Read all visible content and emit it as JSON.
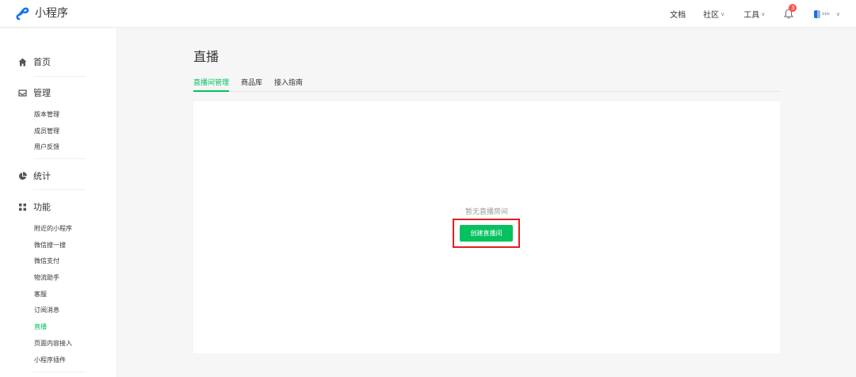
{
  "header": {
    "app_name": "小程序",
    "nav": {
      "docs": "文档",
      "community": "社区",
      "tools": "工具"
    },
    "notification_count": "3",
    "avatar_label": "bbb"
  },
  "sidebar": {
    "home": "首页",
    "manage": {
      "label": "管理",
      "items": [
        "版本管理",
        "成员管理",
        "用户反馈"
      ]
    },
    "stats": "统计",
    "features": {
      "label": "功能",
      "items": [
        "附近的小程序",
        "微信搜一搜",
        "微信支付",
        "物流助手",
        "客服",
        "订阅消息",
        "直播",
        "页面内容接入",
        "小程序插件"
      ],
      "active_item": "直播"
    }
  },
  "main": {
    "title": "直播",
    "tabs": [
      "直播间管理",
      "商品库",
      "接入指南"
    ],
    "active_tab": "直播间管理",
    "empty_text": "暂无直播房间",
    "create_button": "创建直播间"
  },
  "colors": {
    "accent": "#07c160",
    "highlight": "#e02020",
    "badge": "#fa5151"
  },
  "icons": [
    "logo-icon",
    "bell-icon",
    "home-icon",
    "inbox-icon",
    "pie-chart-icon",
    "grid-icon",
    "chevron-down-icon"
  ]
}
